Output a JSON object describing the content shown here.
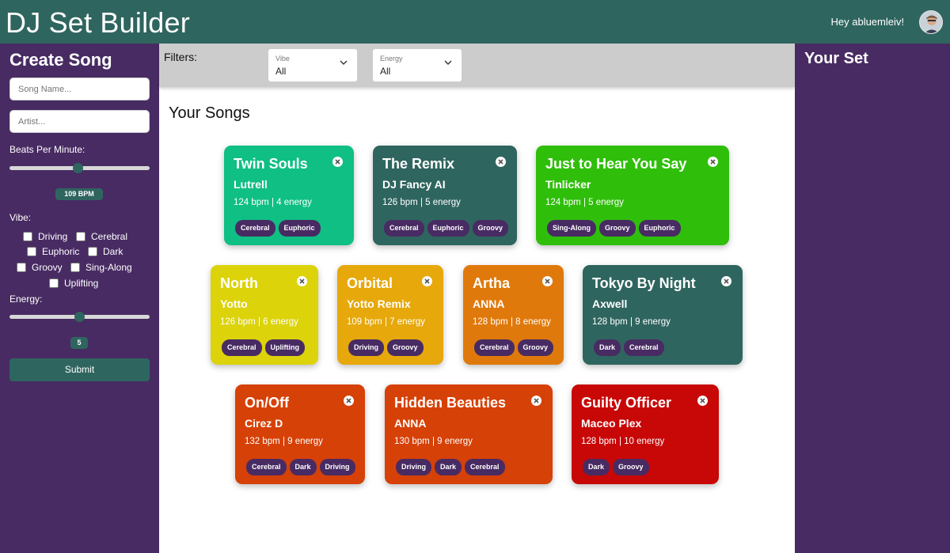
{
  "header": {
    "title": "DJ Set Builder",
    "greeting": "Hey abluemleiv!"
  },
  "create": {
    "title": "Create Song",
    "song_placeholder": "Song Name...",
    "artist_placeholder": "Artist...",
    "bpm_label": "Beats Per Minute:",
    "bpm_value": "109 BPM",
    "vibe_label": "Vibe:",
    "vibes": [
      "Driving",
      "Cerebral",
      "Euphoric",
      "Dark",
      "Groovy",
      "Sing-Along",
      "Uplifting"
    ],
    "energy_label": "Energy:",
    "energy_value": "5",
    "submit": "Submit"
  },
  "filters": {
    "label": "Filters:",
    "vibe_label": "Vibe",
    "vibe_value": "All",
    "energy_label": "Energy",
    "energy_value": "All"
  },
  "songs_title": "Your Songs",
  "set_title": "Your Set",
  "songs": [
    {
      "title": "Twin Souls",
      "artist": "Lutrell",
      "meta": "124 bpm | 4 energy",
      "tags": [
        "Cerebral",
        "Euphoric"
      ],
      "color": "#0fbf84"
    },
    {
      "title": "The Remix",
      "artist": "DJ Fancy AI",
      "meta": "126 bpm | 5 energy",
      "tags": [
        "Cerebral",
        "Euphoric",
        "Groovy"
      ],
      "color": "#2f655f"
    },
    {
      "title": "Just to Hear You Say",
      "artist": "Tinlicker",
      "meta": "124 bpm | 5 energy",
      "tags": [
        "Sing-Along",
        "Groovy",
        "Euphoric"
      ],
      "color": "#2fbf0b"
    },
    {
      "title": "North",
      "artist": "Yotto",
      "meta": "126 bpm | 6 energy",
      "tags": [
        "Cerebral",
        "Uplifting"
      ],
      "color": "#dcd30b"
    },
    {
      "title": "Orbital",
      "artist": "Yotto Remix",
      "meta": "109 bpm | 7 energy",
      "tags": [
        "Driving",
        "Groovy"
      ],
      "color": "#e6a80b"
    },
    {
      "title": "Artha",
      "artist": "ANNA",
      "meta": "128 bpm | 8 energy",
      "tags": [
        "Cerebral",
        "Groovy"
      ],
      "color": "#e0790b"
    },
    {
      "title": "Tokyo By Night",
      "artist": "Axwell",
      "meta": "128 bpm | 9 energy",
      "tags": [
        "Dark",
        "Cerebral"
      ],
      "color": "#2f655f"
    },
    {
      "title": "On/Off",
      "artist": "Cirez D",
      "meta": "132 bpm | 9 energy",
      "tags": [
        "Cerebral",
        "Dark",
        "Driving"
      ],
      "color": "#d64107"
    },
    {
      "title": "Hidden Beauties",
      "artist": "ANNA",
      "meta": "130 bpm | 9 energy",
      "tags": [
        "Driving",
        "Dark",
        "Cerebral"
      ],
      "color": "#d64107"
    },
    {
      "title": "Guilty Officer",
      "artist": "Maceo Plex",
      "meta": "128 bpm | 10 energy",
      "tags": [
        "Dark",
        "Groovy"
      ],
      "color": "#c80707"
    }
  ]
}
